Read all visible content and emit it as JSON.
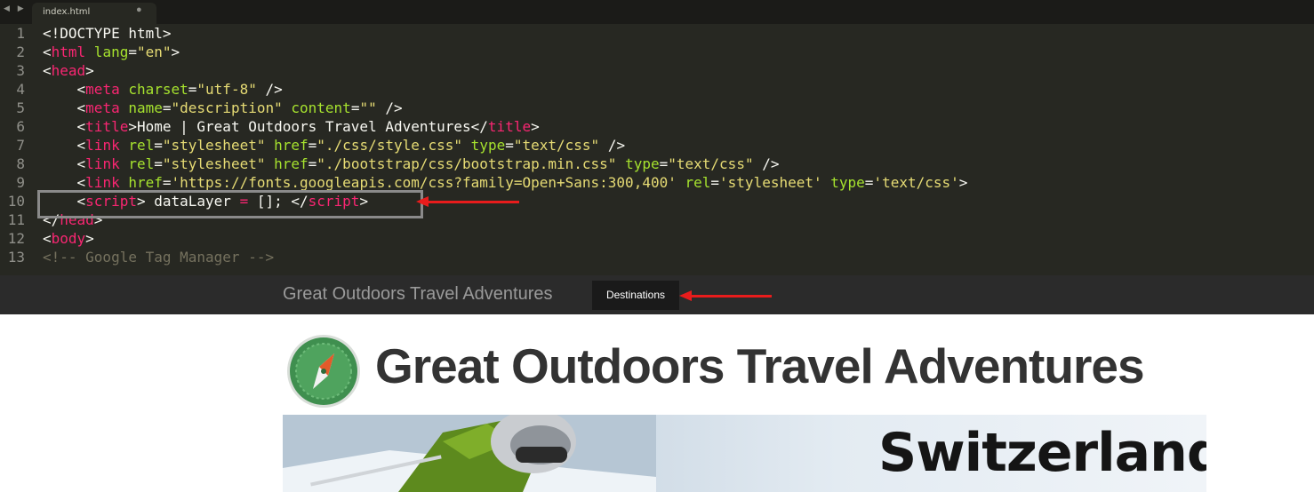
{
  "editor": {
    "nav_arrows": "◀ ▶",
    "tab": {
      "title": "index.html",
      "close": "●"
    },
    "lines": [
      {
        "num": "1",
        "parts": [
          {
            "c": "pl",
            "t": "<!DOCTYPE html>"
          }
        ]
      },
      {
        "num": "2",
        "parts": [
          {
            "c": "pl",
            "t": "<"
          },
          {
            "c": "tag",
            "t": "html"
          },
          {
            "c": "attr",
            "t": " lang"
          },
          {
            "c": "pl",
            "t": "="
          },
          {
            "c": "str",
            "t": "\"en\""
          },
          {
            "c": "pl",
            "t": ">"
          }
        ]
      },
      {
        "num": "3",
        "parts": [
          {
            "c": "pl",
            "t": "<"
          },
          {
            "c": "tag",
            "t": "head"
          },
          {
            "c": "pl",
            "t": ">"
          }
        ]
      },
      {
        "num": "4",
        "parts": [
          {
            "c": "pl",
            "t": "    <"
          },
          {
            "c": "tag",
            "t": "meta"
          },
          {
            "c": "attr",
            "t": " charset"
          },
          {
            "c": "pl",
            "t": "="
          },
          {
            "c": "str",
            "t": "\"utf-8\""
          },
          {
            "c": "pl",
            "t": " />"
          }
        ]
      },
      {
        "num": "5",
        "parts": [
          {
            "c": "pl",
            "t": "    <"
          },
          {
            "c": "tag",
            "t": "meta"
          },
          {
            "c": "attr",
            "t": " name"
          },
          {
            "c": "pl",
            "t": "="
          },
          {
            "c": "str",
            "t": "\"description\""
          },
          {
            "c": "attr",
            "t": " content"
          },
          {
            "c": "pl",
            "t": "="
          },
          {
            "c": "str",
            "t": "\"\""
          },
          {
            "c": "pl",
            "t": " />"
          }
        ]
      },
      {
        "num": "6",
        "parts": [
          {
            "c": "pl",
            "t": "    <"
          },
          {
            "c": "tag",
            "t": "title"
          },
          {
            "c": "pl",
            "t": ">Home | Great Outdoors Travel Adventures</"
          },
          {
            "c": "tag",
            "t": "title"
          },
          {
            "c": "pl",
            "t": ">"
          }
        ]
      },
      {
        "num": "7",
        "parts": [
          {
            "c": "pl",
            "t": "    <"
          },
          {
            "c": "tag",
            "t": "link"
          },
          {
            "c": "attr",
            "t": " rel"
          },
          {
            "c": "pl",
            "t": "="
          },
          {
            "c": "str",
            "t": "\"stylesheet\""
          },
          {
            "c": "attr",
            "t": " href"
          },
          {
            "c": "pl",
            "t": "="
          },
          {
            "c": "str",
            "t": "\"./css/style.css\""
          },
          {
            "c": "attr",
            "t": " type"
          },
          {
            "c": "pl",
            "t": "="
          },
          {
            "c": "str",
            "t": "\"text/css\""
          },
          {
            "c": "pl",
            "t": " />"
          }
        ]
      },
      {
        "num": "8",
        "parts": [
          {
            "c": "pl",
            "t": "    <"
          },
          {
            "c": "tag",
            "t": "link"
          },
          {
            "c": "attr",
            "t": " rel"
          },
          {
            "c": "pl",
            "t": "="
          },
          {
            "c": "str",
            "t": "\"stylesheet\""
          },
          {
            "c": "attr",
            "t": " href"
          },
          {
            "c": "pl",
            "t": "="
          },
          {
            "c": "str",
            "t": "\"./bootstrap/css/bootstrap.min.css\""
          },
          {
            "c": "attr",
            "t": " type"
          },
          {
            "c": "pl",
            "t": "="
          },
          {
            "c": "str",
            "t": "\"text/css\""
          },
          {
            "c": "pl",
            "t": " />"
          }
        ]
      },
      {
        "num": "9",
        "parts": [
          {
            "c": "pl",
            "t": "    <"
          },
          {
            "c": "tag",
            "t": "link"
          },
          {
            "c": "attr",
            "t": " href"
          },
          {
            "c": "pl",
            "t": "="
          },
          {
            "c": "str",
            "t": "'https://fonts.googleapis.com/css?family=Open+Sans:300,400'"
          },
          {
            "c": "attr",
            "t": " rel"
          },
          {
            "c": "pl",
            "t": "="
          },
          {
            "c": "str",
            "t": "'stylesheet'"
          },
          {
            "c": "attr",
            "t": " type"
          },
          {
            "c": "pl",
            "t": "="
          },
          {
            "c": "str",
            "t": "'text/css'"
          },
          {
            "c": "pl",
            "t": ">"
          }
        ]
      },
      {
        "num": "10",
        "parts": [
          {
            "c": "pl",
            "t": "    <"
          },
          {
            "c": "tag",
            "t": "script"
          },
          {
            "c": "pl",
            "t": "> dataLayer "
          },
          {
            "c": "op",
            "t": "="
          },
          {
            "c": "pl",
            "t": " []; </"
          },
          {
            "c": "tag",
            "t": "script"
          },
          {
            "c": "pl",
            "t": ">"
          }
        ]
      },
      {
        "num": "11",
        "parts": [
          {
            "c": "pl",
            "t": "</"
          },
          {
            "c": "tag",
            "t": "head"
          },
          {
            "c": "pl",
            "t": ">"
          }
        ]
      },
      {
        "num": "12",
        "parts": [
          {
            "c": "pl",
            "t": "<"
          },
          {
            "c": "tag",
            "t": "body"
          },
          {
            "c": "pl",
            "t": ">"
          }
        ]
      },
      {
        "num": "13",
        "parts": [
          {
            "c": "cm",
            "t": "<!-- Google Tag Manager -->"
          }
        ]
      }
    ]
  },
  "website": {
    "brand": "Great Outdoors Travel Adventures",
    "nav_items": [
      {
        "label": "Destinations"
      }
    ],
    "page_title": "Great Outdoors Travel Adventures",
    "hero": {
      "title": "Switzerland"
    }
  },
  "colors": {
    "editor_bg": "#272822",
    "tag": "#f92672",
    "attribute": "#a6e22e",
    "string": "#e6db74",
    "annotation_arrow": "#e81c1c",
    "navbar_bg": "#2b2b2b",
    "logo_green": "#3f8f4f"
  },
  "icons": {
    "logo": "compass-icon",
    "annotation": "arrow-left-icon"
  }
}
